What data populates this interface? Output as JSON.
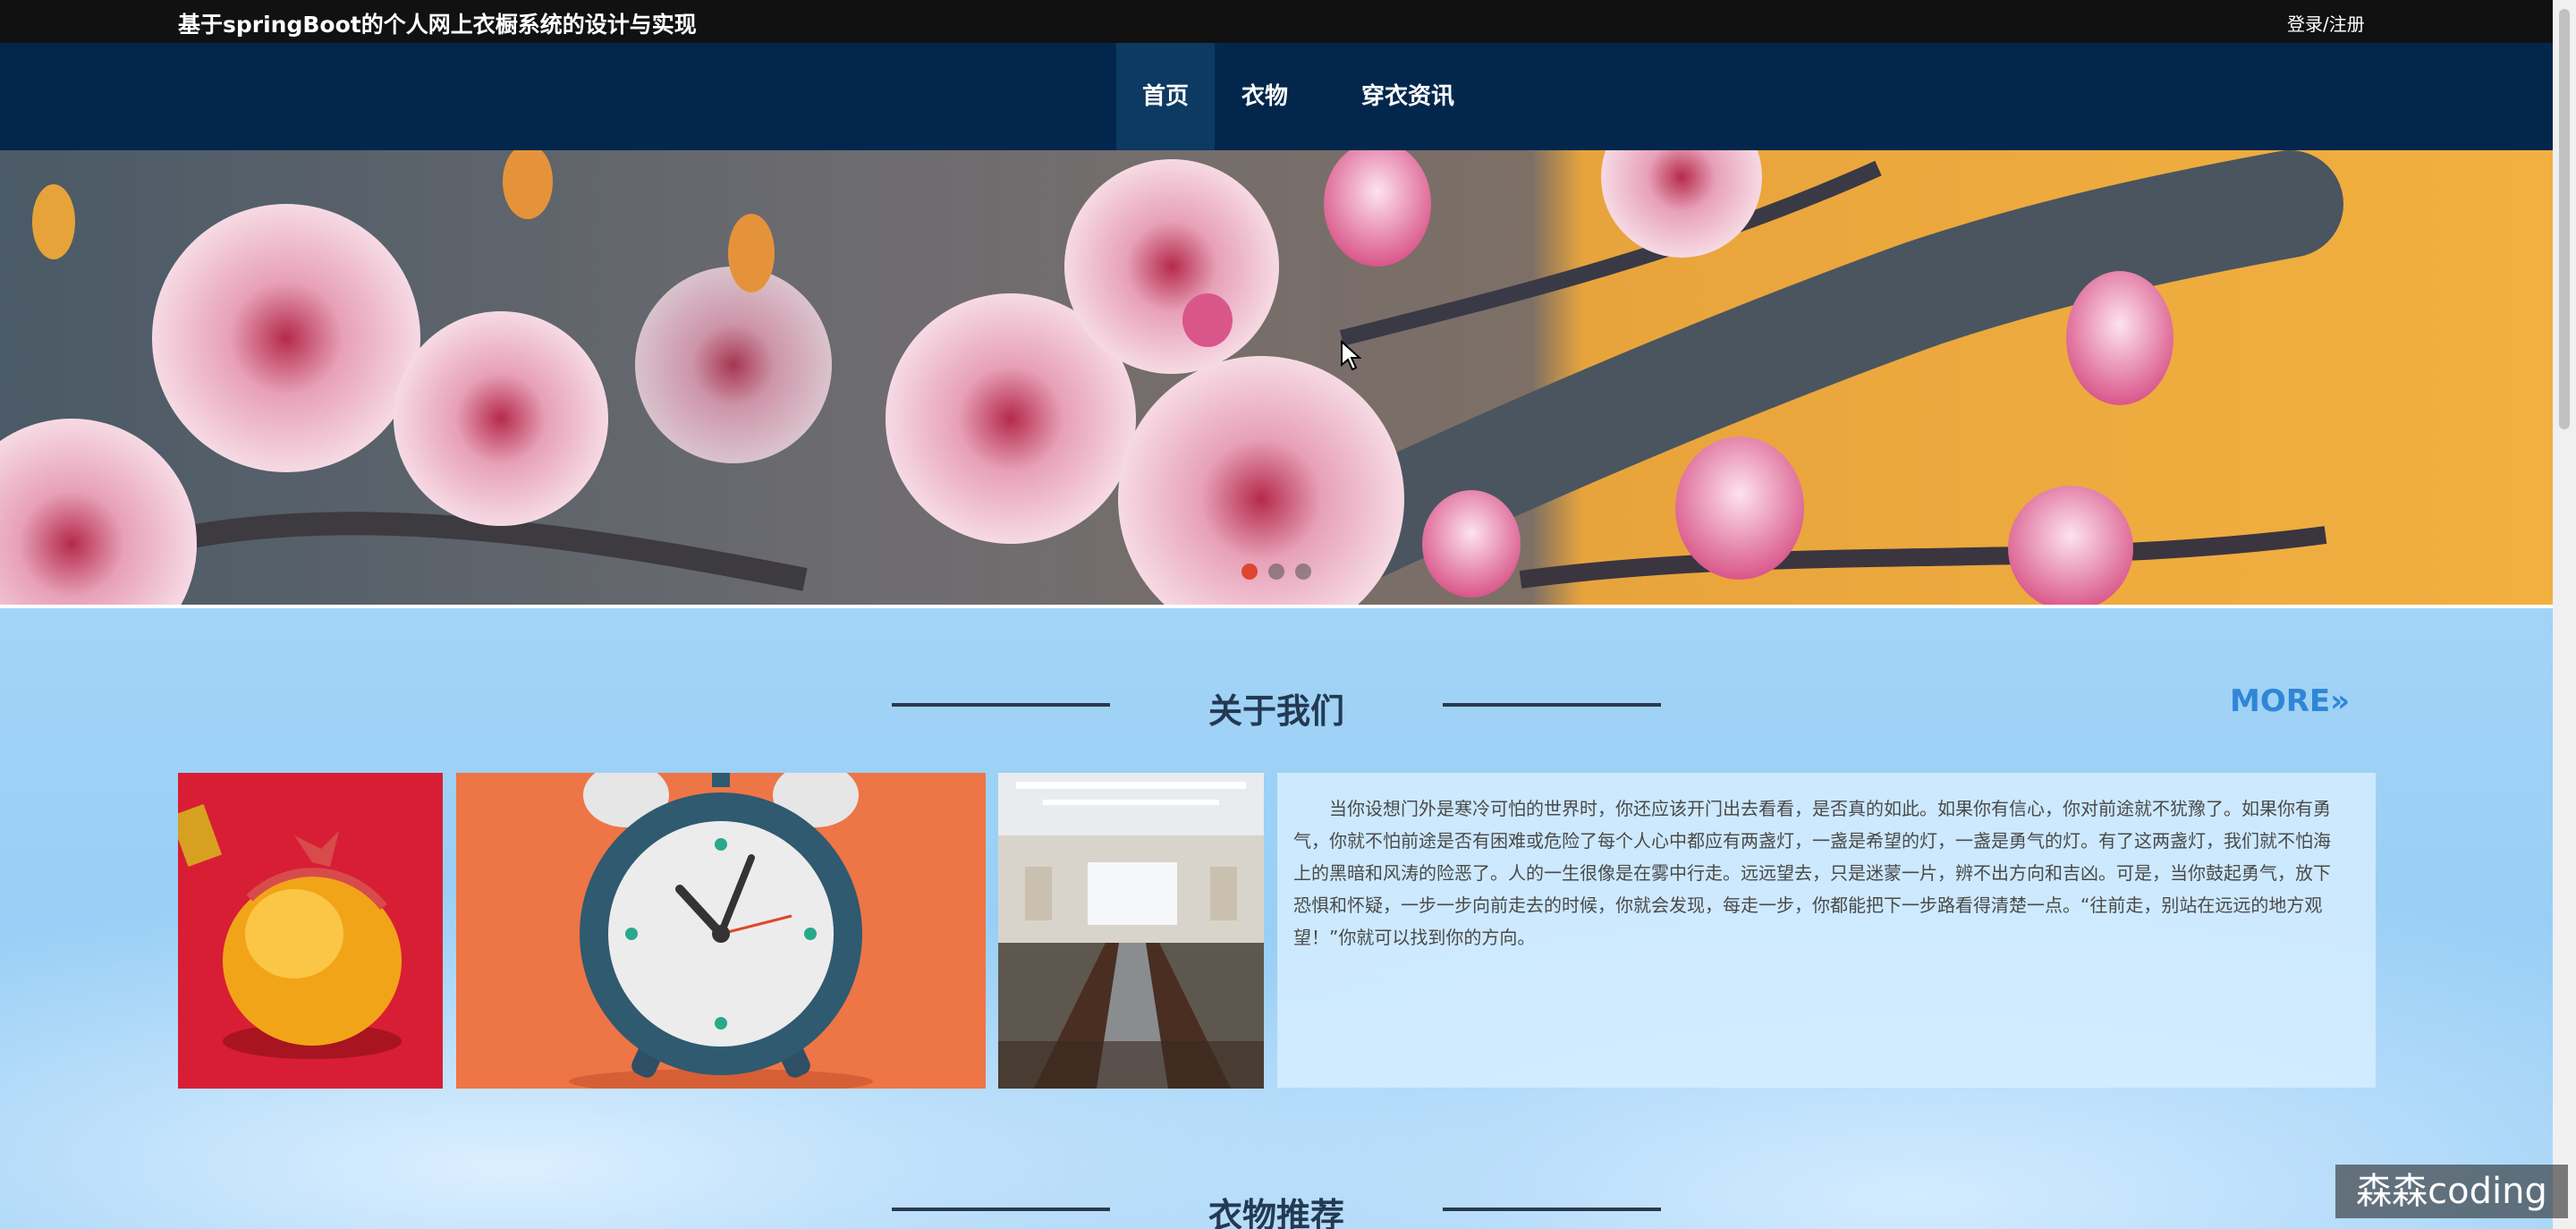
{
  "header": {
    "site_title": "基于springBoot的个人网上衣橱系统的设计与实现",
    "login_link": "登录/注册"
  },
  "nav": {
    "items": [
      {
        "label": "首页",
        "active": true
      },
      {
        "label": "衣物",
        "active": false
      },
      {
        "label": "穿衣资讯",
        "active": false
      }
    ]
  },
  "banner": {
    "slide_count": 3,
    "active_slide": 1,
    "accent_color": "#e0462e"
  },
  "about": {
    "title": "关于我们",
    "more_label": "MORE",
    "more_icon": "double-chevron-right-icon",
    "text": "当你设想门外是寒冷可怕的世界时，你还应该开门出去看看，是否真的如此。如果你有信心，你对前途就不犹豫了。如果你有勇气，你就不怕前途是否有困难或危险了每个人心中都应有两盏灯，一盏是希望的灯，一盏是勇气的灯。有了这两盏灯，我们就不怕海上的黑暗和风涛的险恶了。人的一生很像是在雾中行走。远远望去，只是迷蒙一片，辨不出方向和吉凶。可是，当你鼓起勇气，放下恐惧和怀疑，一步一步向前走去的时候，你就会发现，每走一步，你都能把下一步路看得清楚一点。“往前走，别站在远远的地方观望！”你就可以找到你的方向。",
    "images": [
      "gold-egg-image",
      "alarm-clock-image",
      "conference-room-image"
    ]
  },
  "recommend": {
    "title": "衣物推荐"
  },
  "watermark": "森森coding",
  "colors": {
    "topbar": "#111111",
    "navbar": "#03274c",
    "section_bg": "#9fd2f6",
    "more": "#2f86d6"
  }
}
